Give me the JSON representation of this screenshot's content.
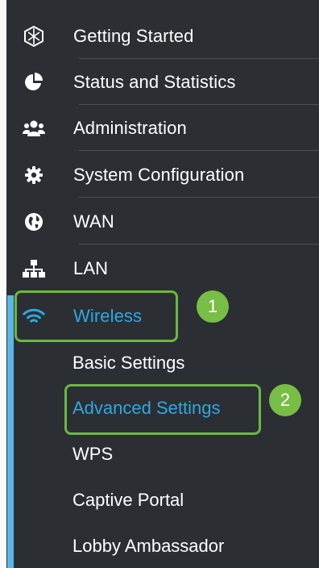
{
  "menu": {
    "items": [
      {
        "label": "Getting Started",
        "icon": "getting-started-icon"
      },
      {
        "label": "Status and Statistics",
        "icon": "pie-chart-icon"
      },
      {
        "label": "Administration",
        "icon": "users-icon"
      },
      {
        "label": "System Configuration",
        "icon": "gear-icon"
      },
      {
        "label": "WAN",
        "icon": "globe-icon"
      },
      {
        "label": "LAN",
        "icon": "network-icon"
      },
      {
        "label": "Wireless",
        "icon": "wifi-icon"
      }
    ],
    "wireless_subitems": [
      {
        "label": "Basic Settings"
      },
      {
        "label": "Advanced Settings"
      },
      {
        "label": "WPS"
      },
      {
        "label": "Captive Portal"
      },
      {
        "label": "Lobby Ambassador"
      }
    ]
  },
  "callouts": [
    {
      "number": "1"
    },
    {
      "number": "2"
    }
  ],
  "colors": {
    "panel": "#2b2f33",
    "accent_blue": "#2fa7e3",
    "callout_green": "#78bd45"
  }
}
